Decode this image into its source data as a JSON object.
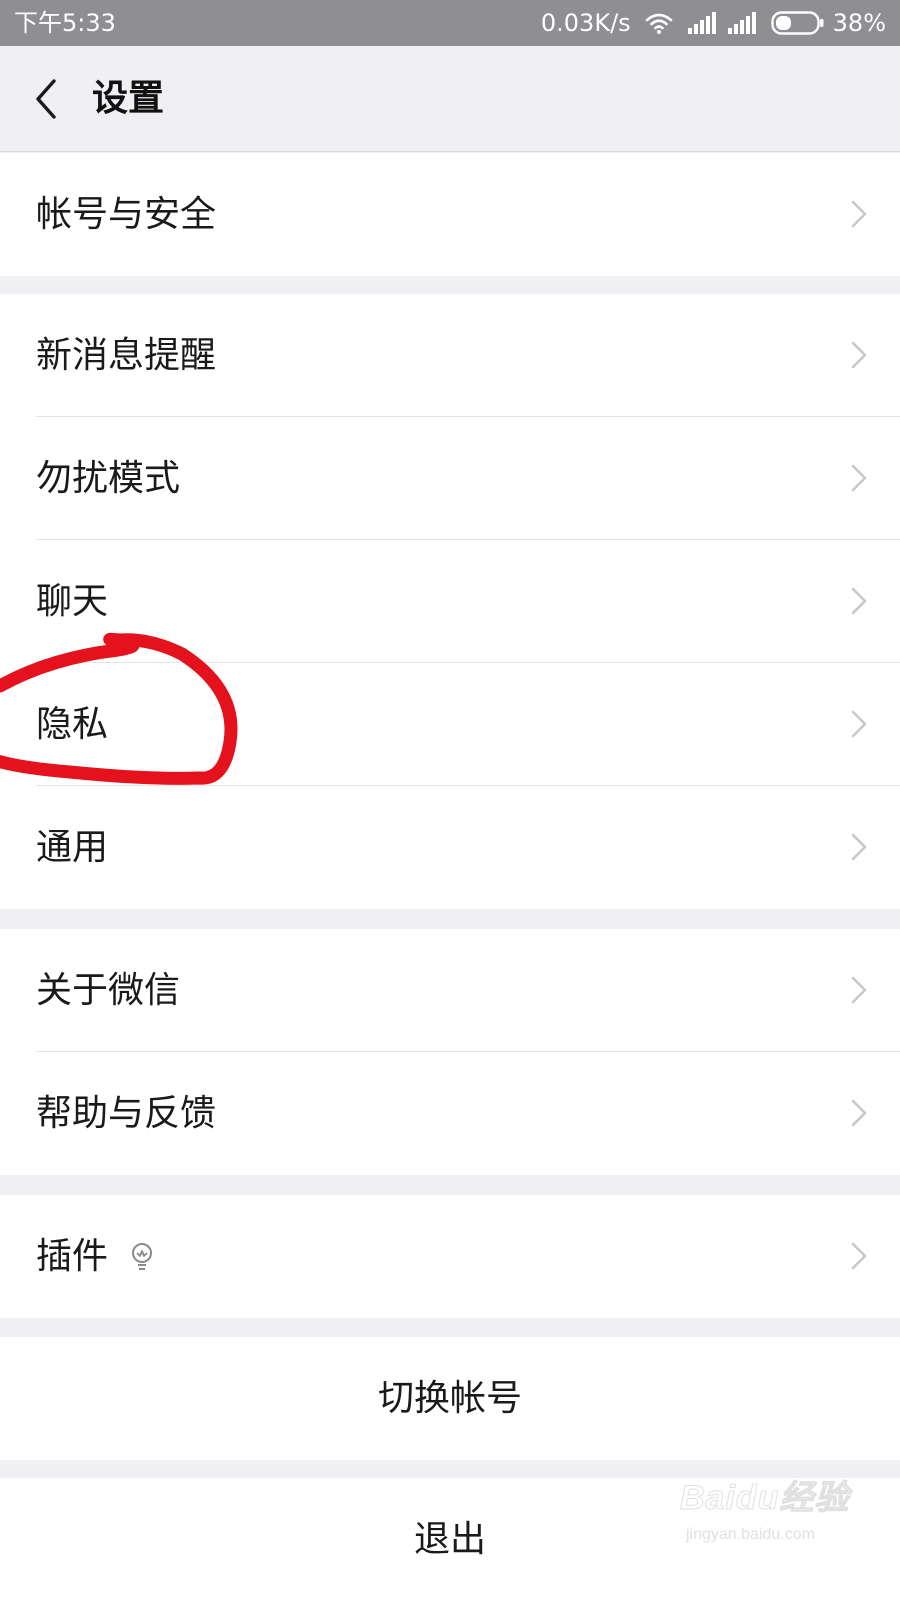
{
  "status_bar": {
    "time": "下午5:33",
    "net_speed": "0.03K/s",
    "battery": "38%",
    "battery_level": 0.38,
    "icons": [
      "wifi-icon",
      "signal-icon",
      "signal-icon",
      "battery-icon"
    ]
  },
  "nav": {
    "title": "设置",
    "back_icon": "chevron-left-icon"
  },
  "rows": {
    "account_security": "帐号与安全",
    "new_message_alerts": "新消息提醒",
    "do_not_disturb": "勿扰模式",
    "chat": "聊天",
    "privacy": "隐私",
    "general": "通用",
    "about_wechat": "关于微信",
    "help_feedback": "帮助与反馈",
    "plugins": "插件"
  },
  "actions": {
    "switch_account": "切换帐号",
    "logout": "退出"
  },
  "annotation": {
    "target": "隐私",
    "color": "#e3121d"
  },
  "watermark": {
    "brand": "Baidu经验",
    "url": "jingyan.baidu.com"
  },
  "colors": {
    "status_bar": "#8e8e93",
    "background": "#efeff4",
    "row": "#ffffff",
    "text": "#1a1a1a",
    "chevron": "#c7c7cc"
  }
}
